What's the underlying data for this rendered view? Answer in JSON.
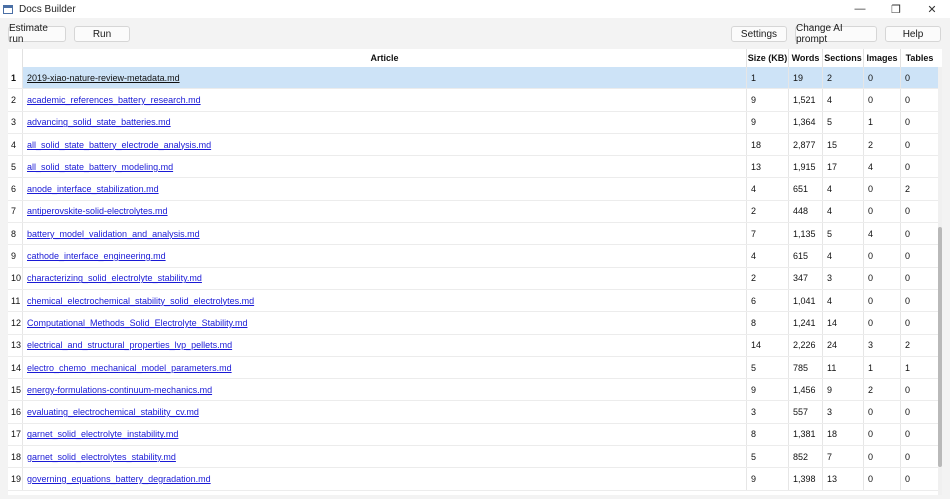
{
  "window": {
    "title": "Docs Builder",
    "controls": {
      "minimize": "—",
      "restore": "❐",
      "close": "✕"
    }
  },
  "toolbar": {
    "estimate_run": "Estimate run",
    "run": "Run",
    "settings": "Settings",
    "change_ai_prompt": "Change AI prompt",
    "help": "Help"
  },
  "table": {
    "columns": [
      "Article",
      "Size (KB)",
      "Words",
      "Sections",
      "Images",
      "Tables"
    ],
    "selected_row": 1,
    "rows": [
      {
        "n": "1",
        "article": "2019-xiao-nature-review-metadata.md",
        "size": "1",
        "words": "19",
        "sections": "2",
        "images": "0",
        "tables": "0"
      },
      {
        "n": "2",
        "article": "academic_references_battery_research.md",
        "size": "9",
        "words": "1,521",
        "sections": "4",
        "images": "0",
        "tables": "0"
      },
      {
        "n": "3",
        "article": "advancing_solid_state_batteries.md",
        "size": "9",
        "words": "1,364",
        "sections": "5",
        "images": "1",
        "tables": "0"
      },
      {
        "n": "4",
        "article": "all_solid_state_battery_electrode_analysis.md",
        "size": "18",
        "words": "2,877",
        "sections": "15",
        "images": "2",
        "tables": "0"
      },
      {
        "n": "5",
        "article": "all_solid_state_battery_modeling.md",
        "size": "13",
        "words": "1,915",
        "sections": "17",
        "images": "4",
        "tables": "0"
      },
      {
        "n": "6",
        "article": "anode_interface_stabilization.md",
        "size": "4",
        "words": "651",
        "sections": "4",
        "images": "0",
        "tables": "2"
      },
      {
        "n": "7",
        "article": "antiperovskite-solid-electrolytes.md",
        "size": "2",
        "words": "448",
        "sections": "4",
        "images": "0",
        "tables": "0"
      },
      {
        "n": "8",
        "article": "battery_model_validation_and_analysis.md",
        "size": "7",
        "words": "1,135",
        "sections": "5",
        "images": "4",
        "tables": "0"
      },
      {
        "n": "9",
        "article": "cathode_interface_engineering.md",
        "size": "4",
        "words": "615",
        "sections": "4",
        "images": "0",
        "tables": "0"
      },
      {
        "n": "10",
        "article": "characterizing_solid_electrolyte_stability.md",
        "size": "2",
        "words": "347",
        "sections": "3",
        "images": "0",
        "tables": "0"
      },
      {
        "n": "11",
        "article": "chemical_electrochemical_stability_solid_electrolytes.md",
        "size": "6",
        "words": "1,041",
        "sections": "4",
        "images": "0",
        "tables": "0"
      },
      {
        "n": "12",
        "article": "Computational_Methods_Solid_Electrolyte_Stability.md",
        "size": "8",
        "words": "1,241",
        "sections": "14",
        "images": "0",
        "tables": "0"
      },
      {
        "n": "13",
        "article": "electrical_and_structural_properties_lvp_pellets.md",
        "size": "14",
        "words": "2,226",
        "sections": "24",
        "images": "3",
        "tables": "2"
      },
      {
        "n": "14",
        "article": "electro_chemo_mechanical_model_parameters.md",
        "size": "5",
        "words": "785",
        "sections": "11",
        "images": "1",
        "tables": "1"
      },
      {
        "n": "15",
        "article": "energy-formulations-continuum-mechanics.md",
        "size": "9",
        "words": "1,456",
        "sections": "9",
        "images": "2",
        "tables": "0"
      },
      {
        "n": "16",
        "article": "evaluating_electrochemical_stability_cv.md",
        "size": "3",
        "words": "557",
        "sections": "3",
        "images": "0",
        "tables": "0"
      },
      {
        "n": "17",
        "article": "garnet_solid_electrolyte_instability.md",
        "size": "8",
        "words": "1,381",
        "sections": "18",
        "images": "0",
        "tables": "0"
      },
      {
        "n": "18",
        "article": "garnet_solid_electrolytes_stability.md",
        "size": "5",
        "words": "852",
        "sections": "7",
        "images": "0",
        "tables": "0"
      },
      {
        "n": "19",
        "article": "governing_equations_battery_degradation.md",
        "size": "9",
        "words": "1,398",
        "sections": "13",
        "images": "0",
        "tables": "0"
      }
    ]
  },
  "colors": {
    "link": "#1a1ad6",
    "selection": "#cde3f7",
    "background": "#f3f3f3"
  }
}
